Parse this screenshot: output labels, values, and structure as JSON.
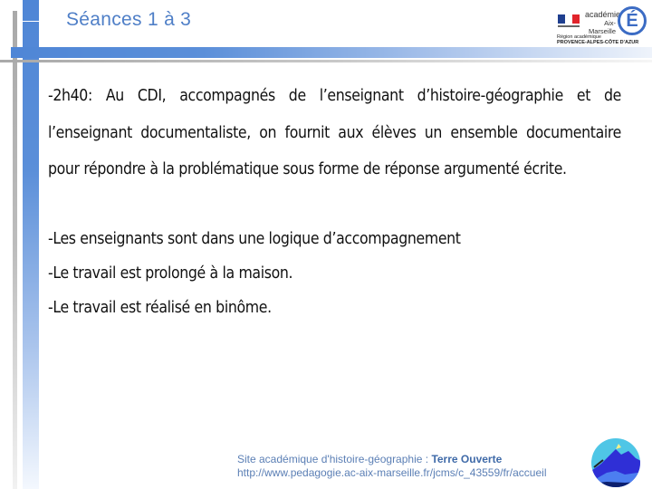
{
  "slide": {
    "title": "Séances 1 à 3",
    "logo": {
      "academie_line1": "académie",
      "academie_line2": "Aix-Marseille",
      "emblem_letter": "É",
      "region_line1": "Région académique",
      "region_line2": "PROVENCE-ALPES-CÔTE D'AZUR"
    },
    "paragraph": "-2h40: Au CDI, accompagnés de l’enseignant d’histoire-géographie et de l’enseignant documentaliste,  on fournit aux élèves un ensemble documentaire pour répondre à la problématique sous forme de réponse argumenté écrite.",
    "items": [
      "-Les enseignants sont dans une logique d’accompagnement",
      "-Le travail est prolongé à la maison.",
      "-Le travail est réalisé en binôme."
    ],
    "footer": {
      "site_prefix": "Site académique d'histoire-géographie : ",
      "site_name": "Terre Ouverte",
      "url": "http://www.pedagogie.ac-aix-marseille.fr/jcms/c_43559/fr/accueil"
    }
  },
  "colors": {
    "accent_blue": "#4f86d6",
    "title_blue": "#4f7fc7",
    "footer_blue": "#5b7fb5",
    "frame_gray": "#a9a9a9"
  }
}
